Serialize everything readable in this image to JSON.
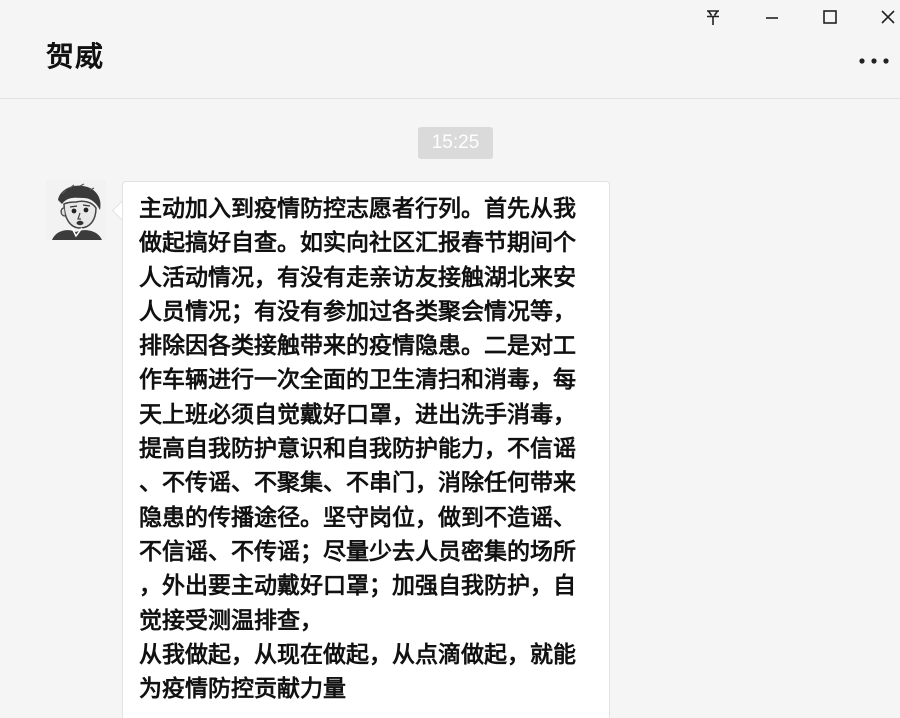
{
  "window": {
    "title": "贺威",
    "controls": {
      "pin": "pin-icon",
      "minimize": "minimize-icon",
      "maximize": "maximize-icon",
      "close": "close-icon",
      "more": "more-icon"
    }
  },
  "chat": {
    "timestamp": "15:25",
    "messages": [
      {
        "sender_avatar": "avatar-sketch",
        "text": "主动加入到疫情防控志愿者行列。首先从我\n做起搞好自查。如实向社区汇报春节期间个\n人活动情况，有没有走亲访友接触湖北来安\n人员情况；有没有参加过各类聚会情况等，\n排除因各类接触带来的疫情隐患。二是对工\n作车辆进行一次全面的卫生清扫和消毒，每\n天上班必须自觉戴好口罩，进出洗手消毒，\n提高自我防护意识和自我防护能力，不信谣\n、不传谣、不聚集、不串门，消除任何带来\n隐患的传播途径。坚守岗位，做到不造谣、\n不信谣、不传谣；尽量少去人员密集的场所\n，外出要主动戴好口罩；加强自我防护，自\n觉接受测温排查，\n从我做起，从现在做起，从点滴做起，就能\n为疫情防控贡献力量"
      }
    ]
  }
}
